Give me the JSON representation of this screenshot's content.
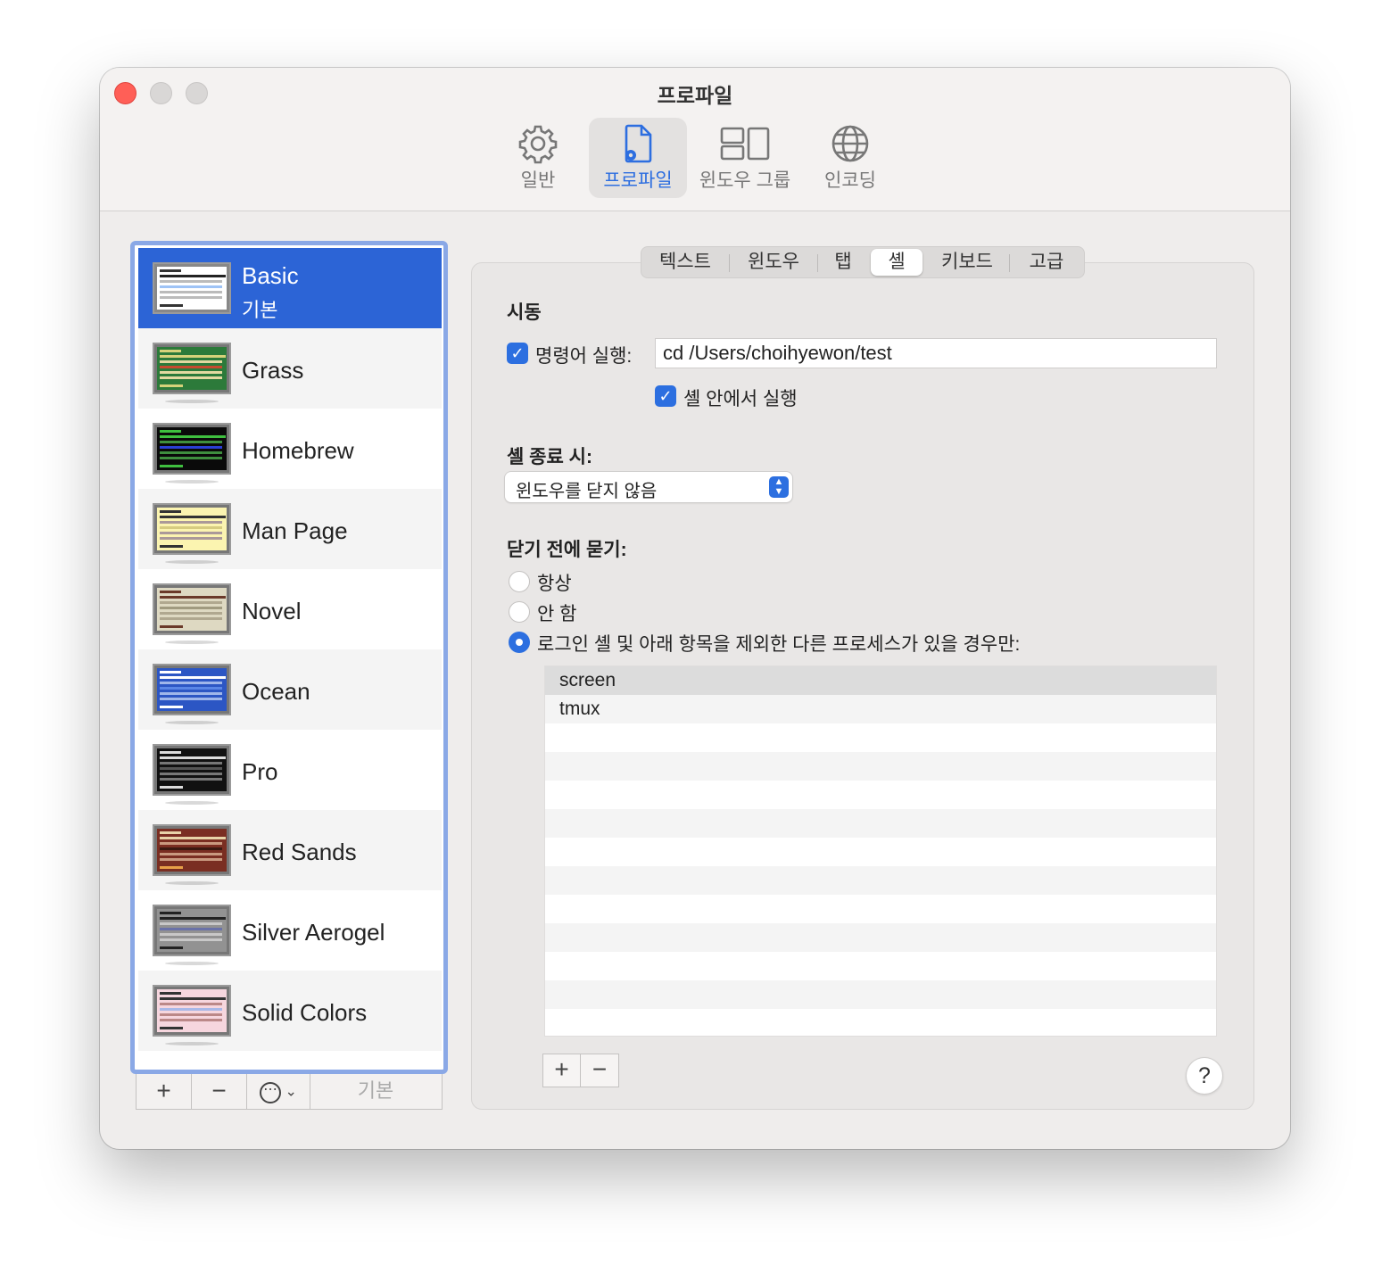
{
  "window": {
    "title": "프로파일"
  },
  "toolbar": {
    "items": [
      {
        "label": "일반",
        "icon": "gear-icon"
      },
      {
        "label": "프로파일",
        "icon": "profile-document-icon"
      },
      {
        "label": "윈도우 그룹",
        "icon": "window-group-icon"
      },
      {
        "label": "인코딩",
        "icon": "globe-icon"
      }
    ],
    "active": "프로파일"
  },
  "profiles": [
    {
      "name": "Basic",
      "sub": "기본",
      "selected": true
    },
    {
      "name": "Grass"
    },
    {
      "name": "Homebrew"
    },
    {
      "name": "Man Page"
    },
    {
      "name": "Novel"
    },
    {
      "name": "Ocean"
    },
    {
      "name": "Pro"
    },
    {
      "name": "Red Sands"
    },
    {
      "name": "Silver Aerogel"
    },
    {
      "name": "Solid Colors"
    }
  ],
  "list_buttons": {
    "add": "+",
    "remove": "−",
    "more": "⋯",
    "default": "기본"
  },
  "tabs": [
    "텍스트",
    "윈도우",
    "탭",
    "셸",
    "키보드",
    "고급"
  ],
  "active_tab": "셸",
  "startup": {
    "heading": "시동",
    "run_command_label": "명령어 실행:",
    "run_command_checked": true,
    "command_value": "cd /Users/choihyewon/test",
    "run_in_shell_label": "셸 안에서 실행",
    "run_in_shell_checked": true
  },
  "on_exit": {
    "heading": "셸 종료 시:",
    "selected_option": "윈도우를 닫지 않음"
  },
  "ask_before_close": {
    "heading": "닫기 전에 묻기:",
    "options": [
      "항상",
      "안 함",
      "로그인 셸 및 아래 항목을 제외한 다른 프로세스가 있을 경우만:"
    ],
    "selected_index": 2
  },
  "process_list": [
    "screen",
    "tmux"
  ],
  "table_buttons": {
    "add": "+",
    "remove": "−"
  },
  "help_label": "?",
  "colors": {
    "accent": "#2c6fe0",
    "selection": "#2c64d6",
    "close": "#ff5f57"
  }
}
